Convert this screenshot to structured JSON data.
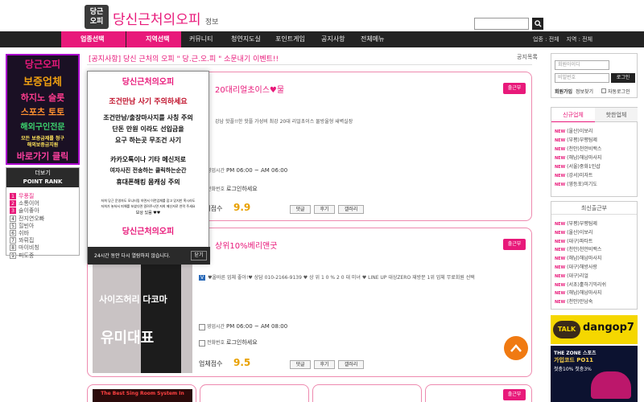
{
  "header": {
    "logo_badge": "당근\n오피",
    "logo_title": "당신근처의오피",
    "logo_suffix": "정보",
    "search_placeholder": "",
    "search_icon": "magnifier-icon"
  },
  "nav": {
    "items": [
      "업종선택",
      "지역선택",
      "커뮤니티",
      "청연지도실",
      "포인트게임",
      "공지사항",
      "전체메뉴"
    ],
    "right_text": "업종 : 전체    지역 : 전체"
  },
  "notice": {
    "text": "[공지사항] 당신 근처의 오피 \" 당.근.오.피 \" 소문내기 이벤트!!",
    "more": "공지목록"
  },
  "left_banner": {
    "lines": [
      "당근오피",
      "보증업체",
      "하지노 슬롯",
      "스포츠 토토",
      "해외구인전문",
      "모든 보증금제를 청구",
      "해외보증금지원",
      "바로가기 클릭"
    ]
  },
  "point_rank": {
    "more_label": "더보기",
    "title": "POINT RANK",
    "items": [
      {
        "rank": "1",
        "name": "무풍질"
      },
      {
        "rank": "2",
        "name": "소통이어"
      },
      {
        "rank": "3",
        "name": "술이좋아"
      },
      {
        "rank": "4",
        "name": "전지연오빠"
      },
      {
        "rank": "5",
        "name": "힐빈아"
      },
      {
        "rank": "6",
        "name": "쉬바"
      },
      {
        "rank": "7",
        "name": "꽈뤼집"
      },
      {
        "rank": "8",
        "name": "마이비칭"
      },
      {
        "rank": "9",
        "name": "피도중"
      }
    ]
  },
  "popup": {
    "logo": "당신근처의오피",
    "warning": "조건만남 사기 주의하세요",
    "lines": [
      "조건만남/출장마사지를 사칭 주의",
      "단돈 만원 이라도 선입금을",
      "요구 하는곳 무조건 사기",
      "카카오톡이나 기타 메신저로",
      "여자사진 전송하는 클릭하는순간",
      "휴대폰해킹 몸캐싱 주의"
    ],
    "small_lines": [
      "저희 당근 운영자도 모니터링 하면서 이런업체를 잡고 있지만 혹시라도",
      "저희가 놓쳐서 피해를 보셨다면 알려주시면 저희 메신저로 연락 주세요",
      "보상 있음 ♥♥"
    ],
    "dismiss_label": "24시간 동안 다시 열람하지 않습니다.",
    "close_label": "닫기"
  },
  "cards": [
    {
      "badge": "출근부",
      "title": "20대리얼초이스♥물",
      "desc": "강남 핫플!!한 핫플 가성비 최강 20대 리얼초이스 물방울형 새벽실장",
      "hours_label": "영업시간",
      "hours": "PM 06:00 ~ AM 06:00",
      "phone_label": "전화번호",
      "phone": "로그인하세요",
      "score_label": "업체점수",
      "score": "9.9",
      "buttons": [
        "댓글",
        "후기",
        "갤러리"
      ]
    },
    {
      "badge": "출근부",
      "title": "상위10%베리앤굿",
      "desc": "♥올바른 업체 좋아!♥ 상담 010-2166-9139 ♥ 상 위 1 0 % 2 0 대 미녀 ♥ LINE UP 대상ZERO 재방문 1위 업체 무료회원 선택",
      "hours_label": "영업시간",
      "hours": "PM 06:00 ~ AM 08:00",
      "phone_label": "전화번호",
      "phone": "로그인하세요",
      "score_label": "업체점수",
      "score": "9.5",
      "buttons": [
        "댓글",
        "후기",
        "갤러리"
      ],
      "thumb_text": [
        "사이즈허리 다코마",
        "유미대표"
      ]
    }
  ],
  "bottom_thumb_text": "The Best Sing Room System In",
  "login": {
    "id_placeholder": "회원아이디",
    "pw_placeholder": "비밀번호",
    "login_button": "로그인",
    "join": "회원가입",
    "find": "정보찾기",
    "auto": "자동로그인"
  },
  "new_posts": {
    "tabs": [
      "신규업체",
      "핫한업체"
    ],
    "items": [
      "(울산)이보리",
      "(부평)부평팀제",
      "(천안)천안비백스",
      "(해남)해남마사지",
      "(서울)중화1인샵",
      "(강서)미자트",
      "(영등포)미기도"
    ]
  },
  "recent_reviews": {
    "title": "최신출근부",
    "items": [
      "(부평)부평팀제",
      "(울산)이보리",
      "(대구)파타트",
      "(천안)천안비백스",
      "(해남)해남마사지",
      "(대구)해방사랑",
      "(대구)리얼",
      "(서초)훌하기믹리쉬",
      "(해남)해남마사지",
      "(천안)만남숙"
    ]
  },
  "talk_banner": {
    "label": "TALK",
    "id": "dangop7"
  },
  "zone_banner": {
    "title": "THE ZONE 스포츠",
    "code": "가입코드 PO11",
    "line2": "첫충10% 첫충3%"
  },
  "colors": {
    "accent": "#e8197a",
    "nav_bg": "#232323",
    "score": "#e8a000"
  }
}
